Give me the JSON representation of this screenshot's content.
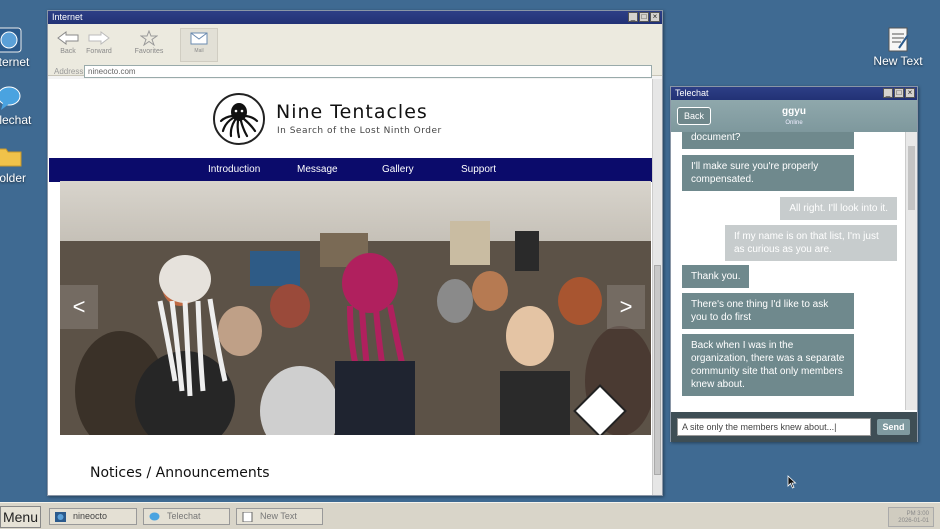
{
  "desktop": {
    "icons_left": [
      {
        "label": "Internet",
        "icon": "globe-icon"
      },
      {
        "label": "Telechat",
        "icon": "chat-bubble-icon"
      },
      {
        "label": "Folder",
        "icon": "folder-icon"
      }
    ],
    "icon_right": {
      "label": "New Text",
      "icon": "notepad-icon"
    }
  },
  "browser": {
    "window_title": "Internet",
    "toolbar": {
      "back_label": "Back",
      "forward_label": "Forward",
      "favorites_label": "Favorites",
      "mail_label": "Mail"
    },
    "address_label": "Address",
    "address_value": "nineocto.com",
    "site": {
      "title": "Nine Tentacles",
      "subtitle": "In Search of the Lost Ninth Order",
      "nav": [
        "Introduction",
        "Message",
        "Gallery",
        "Support"
      ],
      "prev_arrow": "<",
      "next_arrow": ">",
      "notices_heading": "Notices / Announcements"
    }
  },
  "telechat": {
    "window_title": "Telechat",
    "back_label": "Back",
    "contact_name": "ggyu",
    "contact_status": "Online",
    "messages": [
      {
        "dir": "in",
        "text": "document?"
      },
      {
        "dir": "in",
        "text": "I'll make sure you're properly compensated."
      },
      {
        "dir": "out",
        "text": "All right. I'll look into it."
      },
      {
        "dir": "out",
        "text": "If my name is on that list, I'm just as curious as you are."
      },
      {
        "dir": "in",
        "text": "Thank you."
      },
      {
        "dir": "in",
        "text": "There's one thing I'd like to ask you to do first"
      },
      {
        "dir": "in",
        "text": "Back when I was in the organization, there was a separate community site that only members knew about."
      }
    ],
    "input_value": "A site only the members knew about...|",
    "send_label": "Send"
  },
  "taskbar": {
    "menu_label": "Menu",
    "tasks": [
      {
        "label": "nineocto",
        "icon": "globe-icon"
      },
      {
        "label": "Telechat",
        "icon": "chat-bubble-icon"
      },
      {
        "label": "New Text",
        "icon": "notepad-icon"
      }
    ],
    "clock_time": "PM 3:00",
    "clock_date": "2026-01-01"
  },
  "colors": {
    "desktop": "#3f6a92",
    "nav_bar": "#0b0b6b",
    "chat_incoming": "#6f898d",
    "chat_outgoing": "#c7cccd",
    "title_bar": "#223275"
  }
}
